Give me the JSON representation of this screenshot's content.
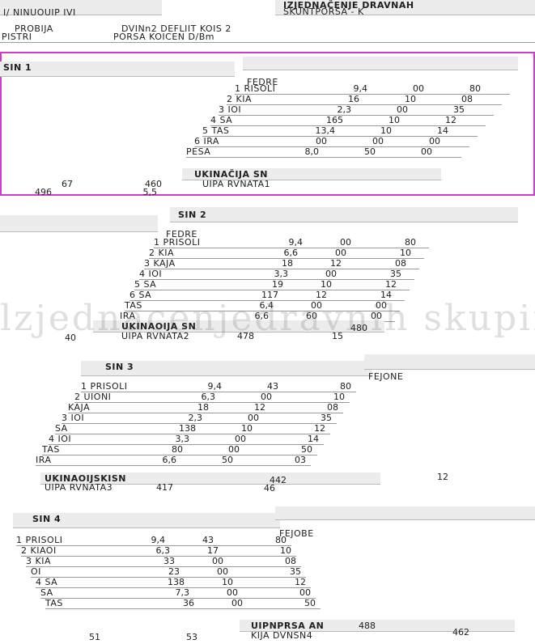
{
  "header": {
    "doc_title": "IZJEDNAČENJE DRAVNAH",
    "subtitle": "SKUNTPORSA - K",
    "col_label_left": "PROBIJA",
    "col_label_mid": "DVINn2 DEFLIIT KOIS 2",
    "col_label_right": "PORSA KOICEN D/Bm",
    "left_tag": "PISTRI",
    "sub_left": "I/ NINUOUIP IVI"
  },
  "blocks": [
    {
      "id": "block-1",
      "title": "SIN 1",
      "sub": "FEDRE",
      "rows": [
        {
          "label": "1 RISOLI",
          "a": "9,4",
          "b": "00",
          "c": "80"
        },
        {
          "label": "2 KIA",
          "a": "16",
          "b": "10",
          "c": "08"
        },
        {
          "label": "3 IOI",
          "a": "2,3",
          "b": "00",
          "c": "35"
        },
        {
          "label": "4 SA",
          "a": "165",
          "b": "10",
          "c": "12"
        },
        {
          "label": "5 TAS",
          "a": "13,4",
          "b": "10",
          "c": "14"
        },
        {
          "label": "6 IRA",
          "a": "00",
          "b": "00",
          "c": "00"
        },
        {
          "label": "PESA",
          "a": "8,0",
          "b": "50",
          "c": "00"
        }
      ],
      "total_label": "UKINAČIJA SN",
      "sum_label": "UIPA RVNATA1",
      "totals": [
        "496",
        "67",
        "460",
        "5,5"
      ]
    },
    {
      "id": "block-2",
      "title": "SIN 2",
      "sub": "FEDRE",
      "rows": [
        {
          "label": "1 PRISOLI",
          "a": "9,4",
          "b": "00",
          "c": "80"
        },
        {
          "label": "2 KIA",
          "a": "6,6",
          "b": "00",
          "c": "10"
        },
        {
          "label": "3 KAJA",
          "a": "18",
          "b": "12",
          "c": "08"
        },
        {
          "label": "4 IOI",
          "a": "3,3",
          "b": "00",
          "c": "35"
        },
        {
          "label": "5 SA",
          "a": "19",
          "b": "10",
          "c": "12"
        },
        {
          "label": "6 SA",
          "a": "117",
          "b": "12",
          "c": "14"
        },
        {
          "label": "TAS",
          "a": "6,4",
          "b": "00",
          "c": "00"
        },
        {
          "label": "IRA",
          "a": "6,6",
          "b": "60",
          "c": "00"
        }
      ],
      "total_label": "UKINAOIJA SN",
      "sum_label": "UIPA RVNATA2",
      "totals": [
        "478",
        "15",
        "480",
        "40"
      ]
    },
    {
      "id": "block-3",
      "title": "SIN 3",
      "sub": "FEJONE",
      "rows": [
        {
          "label": "1 PRISOLI",
          "a": "9,4",
          "b": "43",
          "c": "80"
        },
        {
          "label": "2 UIONI",
          "a": "6,3",
          "b": "00",
          "c": "10"
        },
        {
          "label": "KAJA",
          "a": "18",
          "b": "12",
          "c": "08"
        },
        {
          "label": "3 IOI",
          "a": "2,3",
          "b": "00",
          "c": "35"
        },
        {
          "label": "SA",
          "a": "138",
          "b": "10",
          "c": "12"
        },
        {
          "label": "4 IOI",
          "a": "3,3",
          "b": "00",
          "c": "14"
        },
        {
          "label": "TAS",
          "a": "80",
          "b": "00",
          "c": "50"
        },
        {
          "label": "IRA",
          "a": "6,6",
          "b": "50",
          "c": "03"
        }
      ],
      "total_label": "UKINAOIJSKISN",
      "sum_label": "UIPA RVNATA3",
      "totals": [
        "417",
        "442",
        "46",
        "12"
      ]
    },
    {
      "id": "block-4",
      "title": "SIN 4",
      "sub": "FEJOBE",
      "rows": [
        {
          "label": "1 PRISOLI",
          "a": "9,4",
          "b": "43",
          "c": "80"
        },
        {
          "label": "2 KIAOI",
          "a": "6,3",
          "b": "17",
          "c": "10"
        },
        {
          "label": "3 KIA",
          "a": "33",
          "b": "00",
          "c": "08"
        },
        {
          "label": "OI",
          "a": "23",
          "b": "00",
          "c": "35"
        },
        {
          "label": "4 SA",
          "a": "138",
          "b": "10",
          "c": "12"
        },
        {
          "label": "SA",
          "a": "7,3",
          "b": "00",
          "c": "00"
        },
        {
          "label": "TAS",
          "a": "36",
          "b": "00",
          "c": "50"
        }
      ],
      "total_label": "UIPNPRSA AN",
      "sum_label": "KIJA DVNSN4",
      "totals": [
        "488",
        "462",
        "51",
        "53"
      ]
    }
  ],
  "watermark": "lzjednacenjedravnih skupina"
}
